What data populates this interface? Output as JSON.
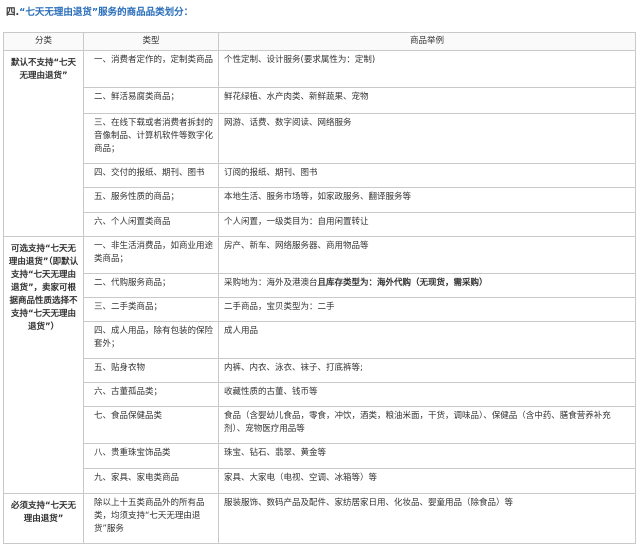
{
  "heading": {
    "prefix": "四.",
    "highlight": "“七天无理由退货”服务的商品品类划分：",
    "suffix": ""
  },
  "table": {
    "headers": [
      "分类",
      "类型",
      "商品举例"
    ],
    "groups": [
      {
        "category": "默认不支持“七天无理由退货”",
        "rows": [
          {
            "type": "一、消费者定作的，定制类商品",
            "example": "个性定制、设计服务(要求属性为：定制)"
          },
          {
            "type": "二、鲜活易腐类商品；",
            "example": "鲜花绿植、水产肉类、新鲜蔬果、宠物"
          },
          {
            "type": "三、在线下载或者消费者拆封的音像制品、计算机软件等数字化商品；",
            "example": "网游、话费、数字阅读、网络服务"
          },
          {
            "type": "四、交付的报纸、期刊、图书",
            "example": "订阅的报纸、期刊、图书"
          },
          {
            "type": "五、服务性质的商品；",
            "example": "本地生活、服务市场等，如家政服务、翻译服务等"
          },
          {
            "type": "六、个人闲置类商品",
            "example": "个人闲置，一级类目为：自用闲置转让"
          }
        ]
      },
      {
        "category": "可选支持“七天无理由退货”（即默认支持“七天无理由退货”，卖家可根据商品性质选择不支持“七天无理由退货”）",
        "rows": [
          {
            "type": "一、非生活消费品，如商业用途类商品；",
            "example": "房产、新车、网络服务器、商用物品等"
          },
          {
            "type": "二、代购服务商品；",
            "example_normal": "采购地为：海外及港澳台",
            "example_bold": "且库存类型为：海外代购（无现货，需采购）"
          },
          {
            "type": "三、二手类商品；",
            "example": "二手商品，宝贝类型为：二手"
          },
          {
            "type": "四、成人用品，除有包装的保险套外；",
            "example": "成人用品"
          },
          {
            "type": "五、贴身衣物",
            "example": "内裤、内衣、泳衣、袜子、打底裤等;"
          },
          {
            "type": "六、古董孤品类；",
            "example": "收藏性质的古董、钱币等"
          },
          {
            "type": "七、食品保健品类",
            "example": "食品（含婴幼儿食品，零食，冲饮，酒类，粮油米面，干货，调味品）、保健品（含中药、膳食营养补充剂）、宠物医疗用品等"
          },
          {
            "type": "八、贵重珠宝饰品类",
            "example": "珠宝、钻石、翡翠、黄金等"
          },
          {
            "type": "九、家具、家电类商品",
            "example": "家具、大家电（电视、空调、冰箱等）等"
          }
        ]
      },
      {
        "category": "必须支持“七天无理由退货”",
        "rows": [
          {
            "type": "除以上十五类商品外的所有品类，均须支持“七天无理由退货”服务",
            "example": "服装服饰、数码产品及配件、家纺居家日用、化妆品、婴童用品（除食品）等"
          }
        ]
      }
    ]
  }
}
